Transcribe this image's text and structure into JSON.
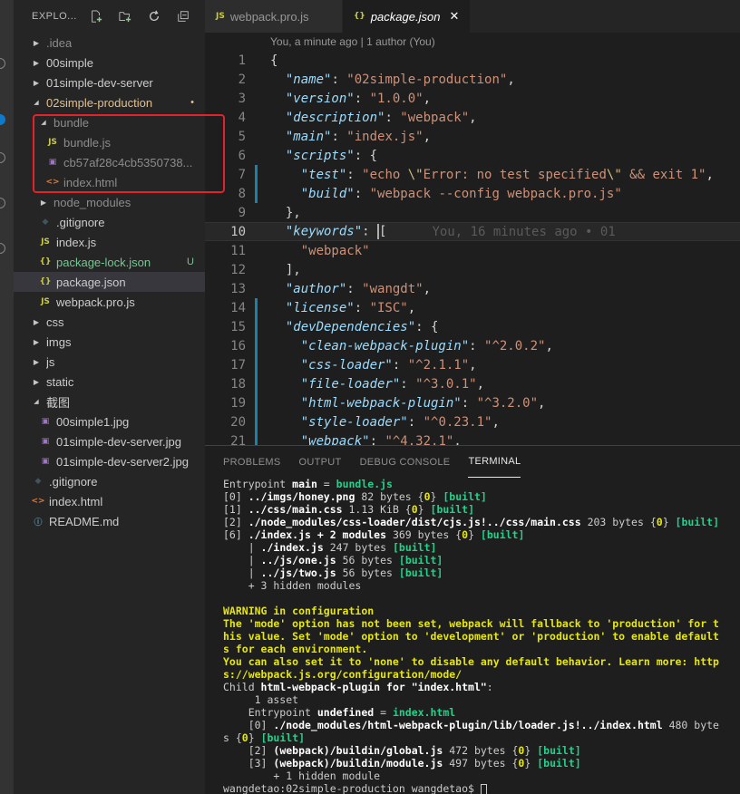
{
  "sidebar": {
    "title": "EXPLO...",
    "tree": [
      {
        "label": ".idea",
        "twisty": "right",
        "indent": 0,
        "cls": "dim"
      },
      {
        "label": "00simple",
        "twisty": "right",
        "indent": 0
      },
      {
        "label": "01simple-dev-server",
        "twisty": "right",
        "indent": 0
      },
      {
        "label": "02simple-production",
        "twisty": "down",
        "indent": 0,
        "cls": "mod",
        "deco": "•"
      },
      {
        "label": "bundle",
        "twisty": "down",
        "indent": 1,
        "cls": "dim"
      },
      {
        "label": "bundle.js",
        "icon": "JS",
        "iconCls": "ic-js",
        "indent": 2,
        "cls": "dim"
      },
      {
        "label": "cb57af28c4cb5350738...",
        "icon": "▣",
        "iconCls": "ic-img",
        "indent": 2,
        "cls": "dim"
      },
      {
        "label": "index.html",
        "icon": "<>",
        "iconCls": "ic-html",
        "indent": 2,
        "cls": "dim"
      },
      {
        "label": "node_modules",
        "twisty": "right",
        "indent": 1,
        "cls": "dim"
      },
      {
        "label": ".gitignore",
        "icon": "◆",
        "iconCls": "ic-git",
        "indent": 1
      },
      {
        "label": "index.js",
        "icon": "JS",
        "iconCls": "ic-js",
        "indent": 1
      },
      {
        "label": "package-lock.json",
        "icon": "{}",
        "iconCls": "ic-json",
        "indent": 1,
        "cls": "untracked",
        "deco": "U"
      },
      {
        "label": "package.json",
        "icon": "{}",
        "iconCls": "ic-json",
        "indent": 1,
        "active": true
      },
      {
        "label": "webpack.pro.js",
        "icon": "JS",
        "iconCls": "ic-js",
        "indent": 1
      },
      {
        "label": "css",
        "twisty": "right",
        "indent": 0
      },
      {
        "label": "imgs",
        "twisty": "right",
        "indent": 0
      },
      {
        "label": "js",
        "twisty": "right",
        "indent": 0
      },
      {
        "label": "static",
        "twisty": "right",
        "indent": 0
      },
      {
        "label": "截图",
        "twisty": "down",
        "indent": 0
      },
      {
        "label": "00simple1.jpg",
        "icon": "▣",
        "iconCls": "ic-img",
        "indent": 1
      },
      {
        "label": "01simple-dev-server.jpg",
        "icon": "▣",
        "iconCls": "ic-img",
        "indent": 1
      },
      {
        "label": "01simple-dev-server2.jpg",
        "icon": "▣",
        "iconCls": "ic-img",
        "indent": 1
      },
      {
        "label": ".gitignore",
        "icon": "◆",
        "iconCls": "ic-git",
        "indent": 0
      },
      {
        "label": "index.html",
        "icon": "<>",
        "iconCls": "ic-html",
        "indent": 0
      },
      {
        "label": "README.md",
        "icon": "ⓘ",
        "iconCls": "ic-info",
        "indent": 0
      }
    ]
  },
  "editor": {
    "tabs": [
      {
        "label": "webpack.pro.js",
        "icon": "JS",
        "active": false
      },
      {
        "label": "package.json",
        "icon": "{}",
        "active": true,
        "italic": true
      }
    ],
    "codelens": "You, a minute ago | 1 author (You)",
    "blame": "You, 16 minutes ago • 01",
    "lines": [
      {
        "n": 1,
        "t": [
          [
            "p",
            "{"
          ]
        ]
      },
      {
        "n": 2,
        "t": [
          [
            "p",
            "  "
          ],
          [
            "k",
            "\"name\""
          ],
          [
            "p",
            ": "
          ],
          [
            "s",
            "\"02simple-production\""
          ],
          [
            "p",
            ","
          ]
        ]
      },
      {
        "n": 3,
        "t": [
          [
            "p",
            "  "
          ],
          [
            "k",
            "\"version\""
          ],
          [
            "p",
            ": "
          ],
          [
            "s",
            "\"1.0.0\""
          ],
          [
            "p",
            ","
          ]
        ]
      },
      {
        "n": 4,
        "t": [
          [
            "p",
            "  "
          ],
          [
            "k",
            "\"description\""
          ],
          [
            "p",
            ": "
          ],
          [
            "s",
            "\"webpack\""
          ],
          [
            "p",
            ","
          ]
        ]
      },
      {
        "n": 5,
        "t": [
          [
            "p",
            "  "
          ],
          [
            "k",
            "\"main\""
          ],
          [
            "p",
            ": "
          ],
          [
            "s",
            "\"index.js\""
          ],
          [
            "p",
            ","
          ]
        ]
      },
      {
        "n": 6,
        "t": [
          [
            "p",
            "  "
          ],
          [
            "k",
            "\"scripts\""
          ],
          [
            "p",
            ": {"
          ]
        ]
      },
      {
        "n": 7,
        "bar": true,
        "t": [
          [
            "p",
            "    "
          ],
          [
            "k",
            "\"test\""
          ],
          [
            "p",
            ": "
          ],
          [
            "s",
            "\"echo "
          ],
          [
            "e",
            "\\\""
          ],
          [
            "s",
            "Error: no test specified"
          ],
          [
            "e",
            "\\\""
          ],
          [
            "s",
            " && exit 1\""
          ],
          [
            "p",
            ","
          ]
        ]
      },
      {
        "n": 8,
        "bar": true,
        "t": [
          [
            "p",
            "    "
          ],
          [
            "k",
            "\"build\""
          ],
          [
            "p",
            ": "
          ],
          [
            "s",
            "\"webpack --config webpack.pro.js\""
          ]
        ]
      },
      {
        "n": 9,
        "t": [
          [
            "p",
            "  },"
          ]
        ]
      },
      {
        "n": 10,
        "cur": true,
        "t": [
          [
            "p",
            "  "
          ],
          [
            "k",
            "\"keywords\""
          ],
          [
            "p",
            ": "
          ],
          [
            "c",
            ""
          ],
          [
            "p",
            "["
          ]
        ]
      },
      {
        "n": 11,
        "t": [
          [
            "p",
            "    "
          ],
          [
            "s",
            "\"webpack\""
          ]
        ]
      },
      {
        "n": 12,
        "t": [
          [
            "p",
            "  ],"
          ]
        ]
      },
      {
        "n": 13,
        "t": [
          [
            "p",
            "  "
          ],
          [
            "k",
            "\"author\""
          ],
          [
            "p",
            ": "
          ],
          [
            "s",
            "\"wangdt\""
          ],
          [
            "p",
            ","
          ]
        ]
      },
      {
        "n": 14,
        "bar": true,
        "t": [
          [
            "p",
            "  "
          ],
          [
            "k",
            "\"license\""
          ],
          [
            "p",
            ": "
          ],
          [
            "s",
            "\"ISC\""
          ],
          [
            "p",
            ","
          ]
        ]
      },
      {
        "n": 15,
        "bar": true,
        "t": [
          [
            "p",
            "  "
          ],
          [
            "k",
            "\"devDependencies\""
          ],
          [
            "p",
            ": {"
          ]
        ]
      },
      {
        "n": 16,
        "bar": true,
        "t": [
          [
            "p",
            "    "
          ],
          [
            "k",
            "\"clean-webpack-plugin\""
          ],
          [
            "p",
            ": "
          ],
          [
            "s",
            "\"^2.0.2\""
          ],
          [
            "p",
            ","
          ]
        ]
      },
      {
        "n": 17,
        "bar": true,
        "t": [
          [
            "p",
            "    "
          ],
          [
            "k",
            "\"css-loader\""
          ],
          [
            "p",
            ": "
          ],
          [
            "s",
            "\"^2.1.1\""
          ],
          [
            "p",
            ","
          ]
        ]
      },
      {
        "n": 18,
        "bar": true,
        "t": [
          [
            "p",
            "    "
          ],
          [
            "k",
            "\"file-loader\""
          ],
          [
            "p",
            ": "
          ],
          [
            "s",
            "\"^3.0.1\""
          ],
          [
            "p",
            ","
          ]
        ]
      },
      {
        "n": 19,
        "bar": true,
        "t": [
          [
            "p",
            "    "
          ],
          [
            "k",
            "\"html-webpack-plugin\""
          ],
          [
            "p",
            ": "
          ],
          [
            "s",
            "\"^3.2.0\""
          ],
          [
            "p",
            ","
          ]
        ]
      },
      {
        "n": 20,
        "bar": true,
        "t": [
          [
            "p",
            "    "
          ],
          [
            "k",
            "\"style-loader\""
          ],
          [
            "p",
            ": "
          ],
          [
            "s",
            "\"^0.23.1\""
          ],
          [
            "p",
            ","
          ]
        ]
      },
      {
        "n": 21,
        "bar": true,
        "t": [
          [
            "p",
            "    "
          ],
          [
            "k",
            "\"webpack\""
          ],
          [
            "p",
            ": "
          ],
          [
            "s",
            "\"^4.32.1\""
          ],
          [
            "p",
            ","
          ]
        ]
      }
    ]
  },
  "panel": {
    "tabs": [
      "PROBLEMS",
      "OUTPUT",
      "DEBUG CONSOLE",
      "TERMINAL"
    ],
    "active_tab": "TERMINAL",
    "lines": [
      [
        [
          "",
          "Entrypoint "
        ],
        [
          "w",
          "main"
        ],
        [
          "",
          " = "
        ],
        [
          "g",
          "bundle.js"
        ]
      ],
      [
        [
          "",
          "[0] "
        ],
        [
          "w",
          "../imgs/honey.png"
        ],
        [
          "",
          " 82 bytes {"
        ],
        [
          "y",
          "0"
        ],
        [
          "",
          "} "
        ],
        [
          "g",
          "[built]"
        ]
      ],
      [
        [
          "",
          "[1] "
        ],
        [
          "w",
          "../css/main.css"
        ],
        [
          "",
          " 1.13 KiB {"
        ],
        [
          "y",
          "0"
        ],
        [
          "",
          "} "
        ],
        [
          "g",
          "[built]"
        ]
      ],
      [
        [
          "",
          "[2] "
        ],
        [
          "w",
          "./node_modules/css-loader/dist/cjs.js!../css/main.css"
        ],
        [
          "",
          " 203 bytes {"
        ],
        [
          "y",
          "0"
        ],
        [
          "",
          "} "
        ],
        [
          "g",
          "[built]"
        ]
      ],
      [
        [
          "",
          "[6] "
        ],
        [
          "w",
          "./index.js + 2 modules"
        ],
        [
          "",
          " 369 bytes {"
        ],
        [
          "y",
          "0"
        ],
        [
          "",
          "} "
        ],
        [
          "g",
          "[built]"
        ]
      ],
      [
        [
          "",
          "    | "
        ],
        [
          "w",
          "./index.js"
        ],
        [
          "",
          " 247 bytes "
        ],
        [
          "g",
          "[built]"
        ]
      ],
      [
        [
          "",
          "    | "
        ],
        [
          "w",
          "../js/one.js"
        ],
        [
          "",
          " 56 bytes "
        ],
        [
          "g",
          "[built]"
        ]
      ],
      [
        [
          "",
          "    | "
        ],
        [
          "w",
          "../js/two.js"
        ],
        [
          "",
          " 56 bytes "
        ],
        [
          "g",
          "[built]"
        ]
      ],
      [
        [
          "",
          "    + 3 hidden modules"
        ]
      ],
      [
        [
          "",
          ""
        ]
      ],
      [
        [
          "y",
          "WARNING in configuration"
        ]
      ],
      [
        [
          "y",
          "The 'mode' option has not been set, webpack will fallback to 'production' for t"
        ]
      ],
      [
        [
          "y",
          "his value. Set 'mode' option to 'development' or 'production' to enable default"
        ]
      ],
      [
        [
          "y",
          "s for each environment."
        ]
      ],
      [
        [
          "y",
          "You can also set it to 'none' to disable any default behavior. Learn more: http"
        ]
      ],
      [
        [
          "y",
          "s://webpack.js.org/configuration/mode/"
        ]
      ],
      [
        [
          "",
          "Child "
        ],
        [
          "w",
          "html-webpack-plugin for \"index.html\""
        ],
        [
          "",
          ":"
        ]
      ],
      [
        [
          "",
          "     1 asset"
        ]
      ],
      [
        [
          "",
          "    Entrypoint "
        ],
        [
          "w",
          "undefined"
        ],
        [
          "",
          " = "
        ],
        [
          "g",
          "index.html"
        ]
      ],
      [
        [
          "",
          "    [0] "
        ],
        [
          "w",
          "./node_modules/html-webpack-plugin/lib/loader.js!../index.html"
        ],
        [
          "",
          " 480 byte"
        ]
      ],
      [
        [
          "",
          "s {"
        ],
        [
          "y",
          "0"
        ],
        [
          "",
          "} "
        ],
        [
          "g",
          "[built]"
        ]
      ],
      [
        [
          "",
          "    [2] "
        ],
        [
          "w",
          "(webpack)/buildin/global.js"
        ],
        [
          "",
          " 472 bytes {"
        ],
        [
          "y",
          "0"
        ],
        [
          "",
          "} "
        ],
        [
          "g",
          "[built]"
        ]
      ],
      [
        [
          "",
          "    [3] "
        ],
        [
          "w",
          "(webpack)/buildin/module.js"
        ],
        [
          "",
          " 497 bytes {"
        ],
        [
          "y",
          "0"
        ],
        [
          "",
          "} "
        ],
        [
          "g",
          "[built]"
        ]
      ],
      [
        [
          "",
          "        + 1 hidden module"
        ]
      ],
      [
        [
          "",
          "wangdetao:02simple-production wangdetao$ "
        ],
        [
          "cursor",
          ""
        ]
      ]
    ]
  }
}
